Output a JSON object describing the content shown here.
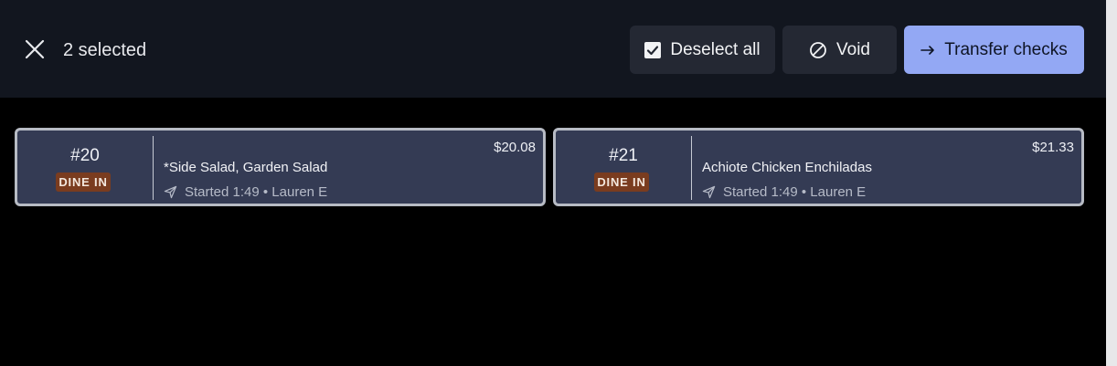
{
  "header": {
    "selected_label": "2 selected",
    "close_icon": "close-icon",
    "actions": {
      "deselect_label": "Deselect all",
      "void_label": "Void",
      "transfer_label": "Transfer checks"
    }
  },
  "checks": [
    {
      "number": "#20",
      "order_type": "DINE IN",
      "price": "$20.08",
      "items": "*Side Salad, Garden Salad",
      "status": "Started 1:49 • Lauren E"
    },
    {
      "number": "#21",
      "order_type": "DINE IN",
      "price": "$21.33",
      "items": "Achiote Chicken Enchiladas",
      "status": "Started 1:49 • Lauren E"
    }
  ],
  "colors": {
    "topbar": "#12161f",
    "card": "#343b54",
    "accent": "#93a8f4",
    "badge": "#7a3c1f"
  }
}
